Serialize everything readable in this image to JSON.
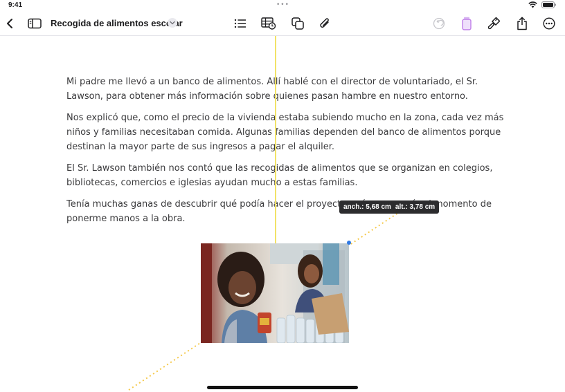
{
  "status_bar": {
    "time": "9:41",
    "center_icon": "more-dots-icon",
    "wifi_icon": "wifi-icon",
    "battery_icon": "battery-icon"
  },
  "toolbar": {
    "title": "Recogida de alimentos escolar",
    "icons": [
      "back-chevron-icon",
      "sidebar-icon",
      "title-menu-chevron-icon",
      "list-icon",
      "table-icon",
      "shapes-icon",
      "attachment-icon",
      "undo-icon",
      "media-icon",
      "format-brush-icon",
      "share-icon",
      "more-icon"
    ],
    "accent_color": "#bf7ee8"
  },
  "document": {
    "paragraphs": [
      "Mi padre me llevó a un banco de alimentos. Allí hablé con el director de voluntariado, el Sr. Lawson, para obtener más información sobre quienes pasan hambre en nuestro entorno.",
      "Nos explicó que, como el precio de la vivienda estaba subiendo mucho en la zona, cada vez más niños y familias necesitaban comida. Algunas familias dependen del banco de alimentos porque destinan la mayor parte de sus ingresos a pagar el alquiler.",
      "El Sr. Lawson también nos contó que las recogidas de alimentos que se organizan en colegios, bibliotecas, comercios e iglesias ayudan mucho a estas familias.",
      "Tenía muchas ganas de descubrir qué podía hacer el proyecto, así que no veía el momento de ponerme manos a la obra."
    ],
    "image": {
      "description_icon": "photo-volunteers-image"
    }
  },
  "size_badge": {
    "width": "anch.: 5,68 cm",
    "height": "alt.: 3,78 cm"
  },
  "colors": {
    "guide": "#f2e268",
    "handle": "#2f7ae5"
  }
}
